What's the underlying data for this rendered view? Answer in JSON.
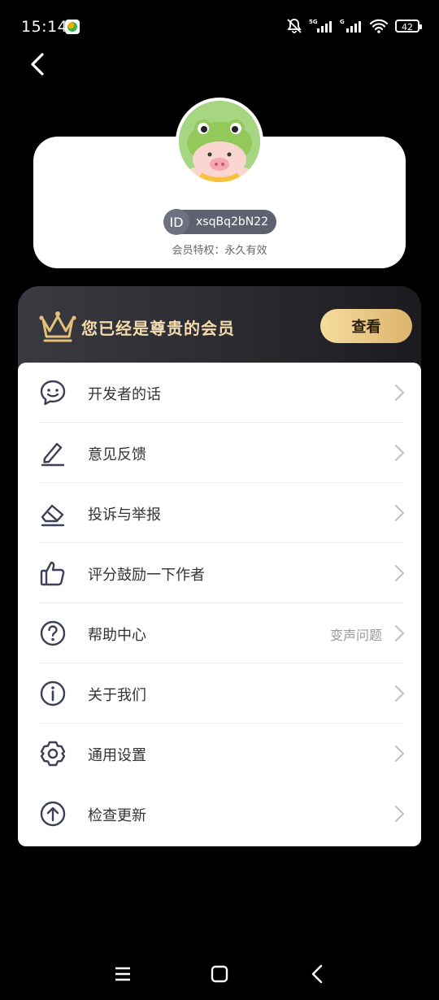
{
  "status_bar": {
    "time": "15:14",
    "battery": "42",
    "icons": [
      "bell-off-icon",
      "signal-5g-icon",
      "signal-g-icon",
      "wifi-icon",
      "battery-icon"
    ]
  },
  "profile": {
    "id_badge": "ID",
    "user_id": "xsqBq2bN22",
    "membership_status": "会员特权：永久有效"
  },
  "vip_banner": {
    "title": "您已经是尊贵的会员",
    "button": "查看",
    "accent": "#f2dcae"
  },
  "menu": {
    "items": [
      {
        "label": "开发者的话",
        "icon": "chat-smile-icon",
        "hint": ""
      },
      {
        "label": "意见反馈",
        "icon": "pencil-icon",
        "hint": ""
      },
      {
        "label": "投诉与举报",
        "icon": "eraser-icon",
        "hint": ""
      },
      {
        "label": "评分鼓励一下作者",
        "icon": "thumbs-up-icon",
        "hint": ""
      },
      {
        "label": "帮助中心",
        "icon": "help-circle-icon",
        "hint": "变声问题"
      },
      {
        "label": "关于我们",
        "icon": "info-circle-icon",
        "hint": ""
      },
      {
        "label": "通用设置",
        "icon": "gear-icon",
        "hint": ""
      },
      {
        "label": "检查更新",
        "icon": "upload-circle-icon",
        "hint": ""
      }
    ]
  },
  "colors": {
    "background": "#000000",
    "card": "#ffffff",
    "icon_stroke": "#3c3f58",
    "vip_button": "#e8c684"
  }
}
